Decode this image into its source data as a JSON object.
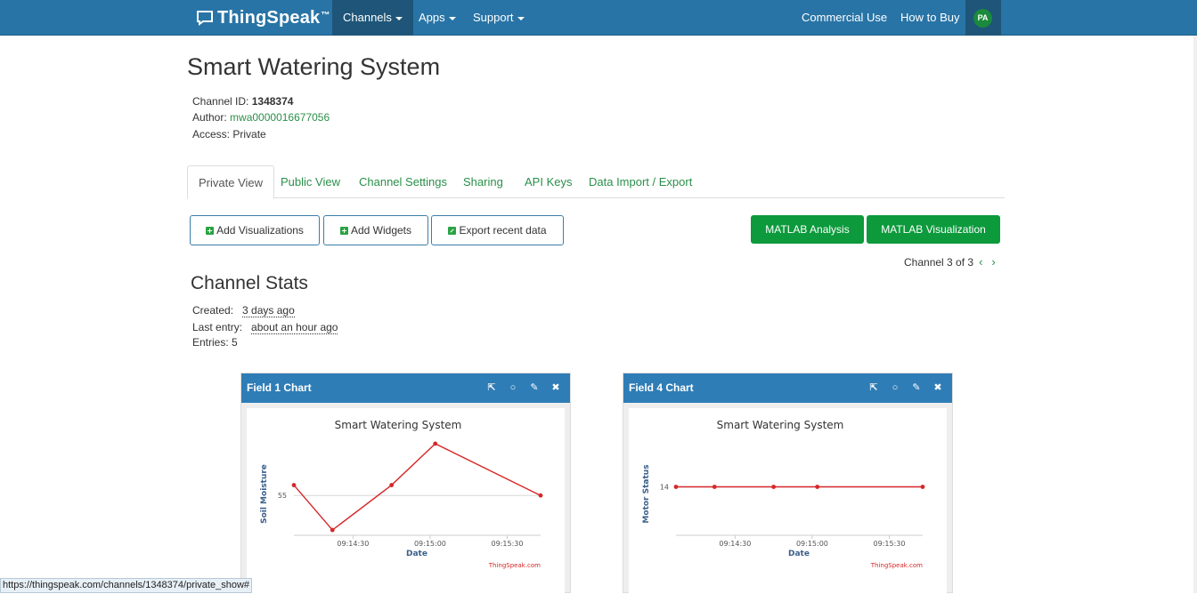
{
  "navbar": {
    "brand": "ThingSpeak",
    "brand_tm": "™",
    "items": [
      {
        "label": "Channels"
      },
      {
        "label": "Apps"
      },
      {
        "label": "Support"
      }
    ],
    "right": [
      {
        "label": "Commercial Use"
      },
      {
        "label": "How to Buy"
      }
    ],
    "avatar": "PA"
  },
  "channel": {
    "title": "Smart Watering System",
    "id_label": "Channel ID:",
    "id_value": "1348374",
    "author_label": "Author:",
    "author_value": "mwa0000016677056",
    "access_label": "Access:",
    "access_value": "Private"
  },
  "tabs": [
    "Private View",
    "Public View",
    "Channel Settings",
    "Sharing",
    "API Keys",
    "Data Import / Export"
  ],
  "buttons": {
    "add_visualizations": "Add Visualizations",
    "add_widgets": "Add Widgets",
    "export_recent": "Export recent data",
    "matlab_analysis": "MATLAB Analysis",
    "matlab_visualization": "MATLAB Visualization"
  },
  "channel_nav": "Channel 3 of 3",
  "stats": {
    "title": "Channel Stats",
    "created_label": "Created:",
    "created_value": "3 days ago",
    "last_label": "Last entry:",
    "last_value": "about an hour ago",
    "entries_label": "Entries:",
    "entries_value": "5"
  },
  "panels": [
    {
      "title": "Field 1 Chart"
    },
    {
      "title": "Field 4 Chart"
    }
  ],
  "chart_data": [
    {
      "type": "line",
      "title": "Smart Watering System",
      "xlabel": "Date",
      "ylabel": "Soil Moisture",
      "credit": "ThingSpeak.com",
      "x_ticks": [
        "09:14:30",
        "09:15:00",
        "09:15:30"
      ],
      "y_ticks": [
        "55"
      ],
      "x": [
        "09:14:07",
        "09:14:22",
        "09:14:45",
        "09:15:02",
        "09:15:43"
      ],
      "values": [
        58,
        45,
        58,
        70,
        55
      ],
      "color": "#d62728"
    },
    {
      "type": "line",
      "title": "Smart Watering System",
      "xlabel": "Date",
      "ylabel": "Motor Status",
      "credit": "ThingSpeak.com",
      "x_ticks": [
        "09:14:30",
        "09:15:00",
        "09:15:30"
      ],
      "y_ticks": [
        "14"
      ],
      "x": [
        "09:14:07",
        "09:14:22",
        "09:14:45",
        "09:15:02",
        "09:15:43"
      ],
      "values": [
        14,
        14,
        14,
        14,
        14
      ],
      "color": "#d62728"
    }
  ],
  "status_url": "https://thingspeak.com/channels/1348374/private_show#"
}
